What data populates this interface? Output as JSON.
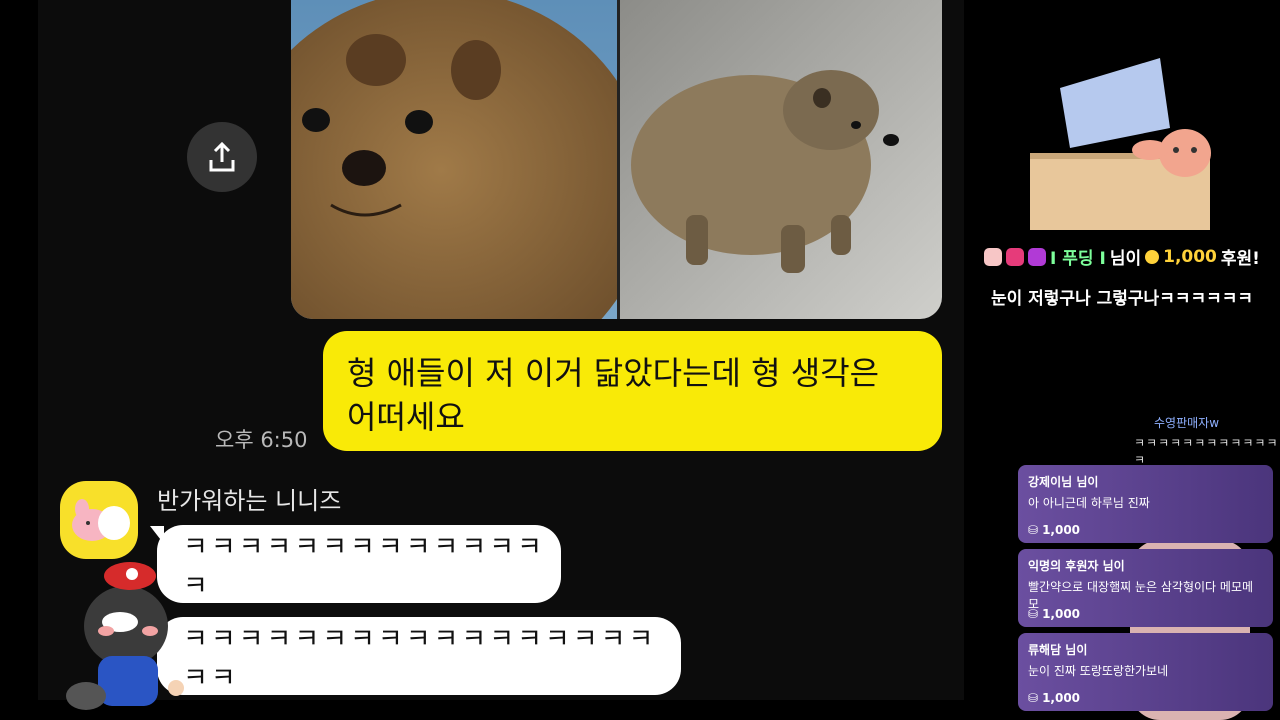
{
  "chat": {
    "my_message": "형 애들이 저 이거 닮았다는데 형 생각은 어떠세요",
    "my_time": "오후 6:50",
    "sender_name": "반가워하는 니니즈",
    "replies": [
      "ㅋㅋㅋㅋㅋㅋㅋㅋㅋㅋㅋㅋㅋㅋ",
      "ㅋㅋㅋㅋㅋㅋㅋㅋㅋㅋㅋㅋㅋㅋㅋㅋㅋㅋㅋ"
    ]
  },
  "overlay": {
    "donation_nick": "I 푸딩 I",
    "donation_suffix": "님이",
    "donation_amount": "1,000",
    "donation_unit": "후원!",
    "donation_message": "눈이 저렇구나 그렇구나ㅋㅋㅋㅋㅋㅋ",
    "chat_user": "수영판매자w",
    "chat_text": "ㅋㅋㅋㅋㅋㅋㅋㅋㅋㅋㅋㅋㅋ"
  },
  "cards": [
    {
      "name": "강제이님 님이",
      "message": "아 아니근데 하루님 진짜",
      "amount": "1,000"
    },
    {
      "name": "익명의 후원자 님이",
      "message": "빨간약으로 대장햄찌 눈은 삼각형이다 메모메모",
      "amount": "1,000"
    },
    {
      "name": "류해담 님이",
      "message": "눈이 진짜 또랑또랑한가보네",
      "amount": "1,000"
    }
  ],
  "icons": {
    "share": "share-icon",
    "coin": "coin-icon"
  },
  "colors": {
    "my_bubble": "#f9ea07",
    "card": "#6b4fa0",
    "amount": "#ffd23a",
    "nick": "#7dff9b"
  }
}
